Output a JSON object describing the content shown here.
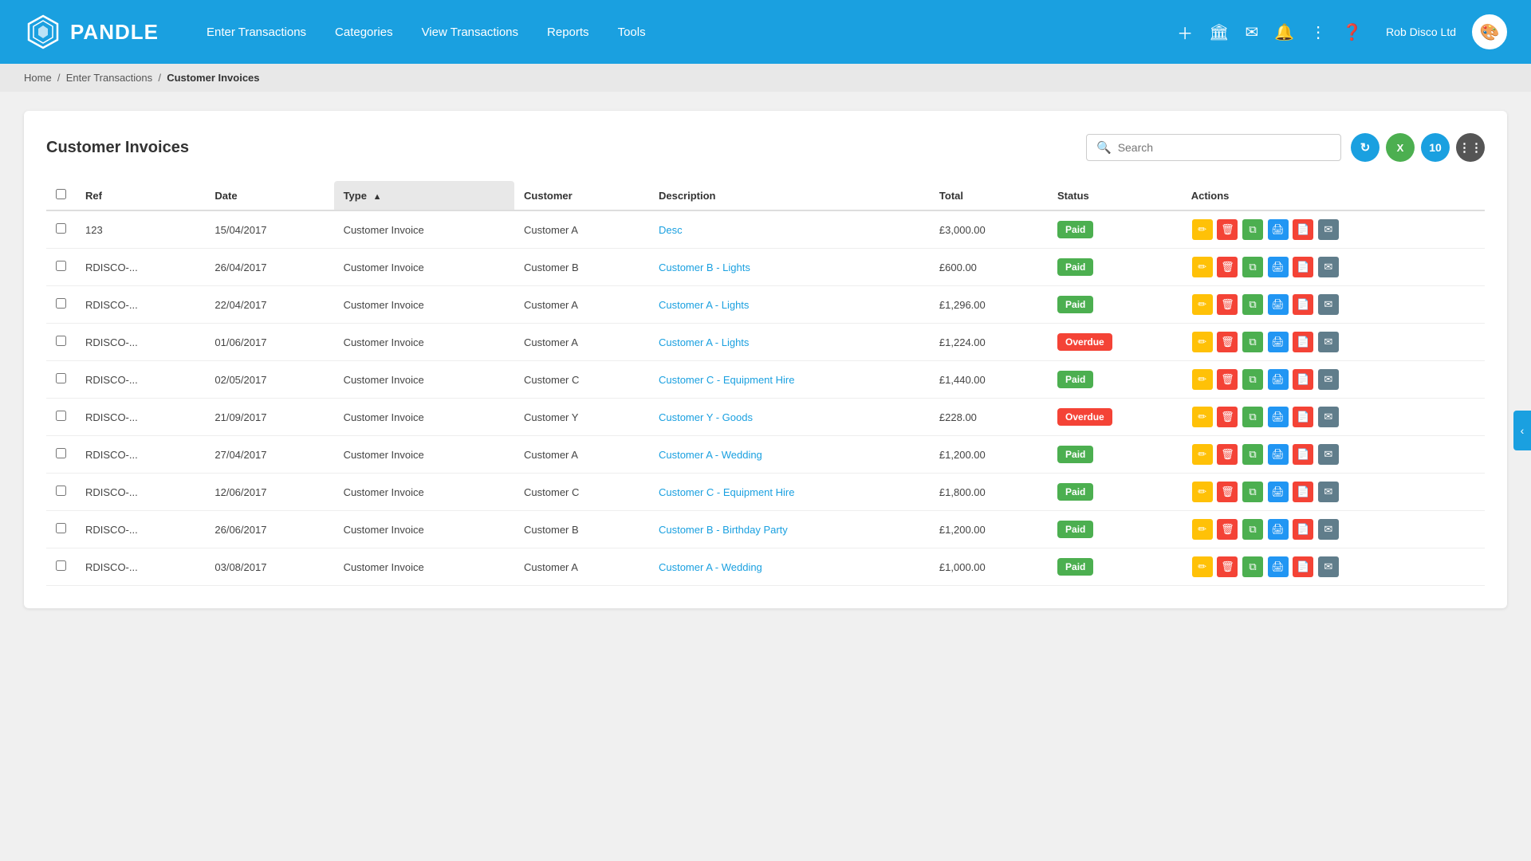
{
  "app": {
    "name": "PANDLE"
  },
  "header": {
    "company": "Rob Disco Ltd",
    "nav": [
      {
        "label": "Enter Transactions",
        "id": "nav-enter-transactions"
      },
      {
        "label": "Categories",
        "id": "nav-categories"
      },
      {
        "label": "View Transactions",
        "id": "nav-view-transactions"
      },
      {
        "label": "Reports",
        "id": "nav-reports"
      },
      {
        "label": "Tools",
        "id": "nav-tools"
      }
    ]
  },
  "breadcrumb": {
    "items": [
      "Home",
      "Enter Transactions",
      "Customer Invoices"
    ]
  },
  "page": {
    "title": "Customer Invoices",
    "search_placeholder": "Search"
  },
  "toolbar": {
    "refresh_label": "↻",
    "excel_label": "X",
    "count_label": "10",
    "columns_label": "⋮⋮"
  },
  "table": {
    "columns": [
      "Ref",
      "Date",
      "Type",
      "Customer",
      "Description",
      "Total",
      "Status",
      "Actions"
    ],
    "rows": [
      {
        "ref": "123",
        "date": "15/04/2017",
        "type": "Customer Invoice",
        "customer": "Customer A",
        "description": "Desc",
        "total": "£3,000.00",
        "status": "Paid"
      },
      {
        "ref": "RDISCO-...",
        "date": "26/04/2017",
        "type": "Customer Invoice",
        "customer": "Customer B",
        "description": "Customer B - Lights",
        "total": "£600.00",
        "status": "Paid"
      },
      {
        "ref": "RDISCO-...",
        "date": "22/04/2017",
        "type": "Customer Invoice",
        "customer": "Customer A",
        "description": "Customer A - Lights",
        "total": "£1,296.00",
        "status": "Paid"
      },
      {
        "ref": "RDISCO-...",
        "date": "01/06/2017",
        "type": "Customer Invoice",
        "customer": "Customer A",
        "description": "Customer A - Lights",
        "total": "£1,224.00",
        "status": "Overdue"
      },
      {
        "ref": "RDISCO-...",
        "date": "02/05/2017",
        "type": "Customer Invoice",
        "customer": "Customer C",
        "description": "Customer C - Equipment Hire",
        "total": "£1,440.00",
        "status": "Paid"
      },
      {
        "ref": "RDISCO-...",
        "date": "21/09/2017",
        "type": "Customer Invoice",
        "customer": "Customer Y",
        "description": "Customer Y - Goods",
        "total": "£228.00",
        "status": "Overdue"
      },
      {
        "ref": "RDISCO-...",
        "date": "27/04/2017",
        "type": "Customer Invoice",
        "customer": "Customer A",
        "description": "Customer A - Wedding",
        "total": "£1,200.00",
        "status": "Paid"
      },
      {
        "ref": "RDISCO-...",
        "date": "12/06/2017",
        "type": "Customer Invoice",
        "customer": "Customer C",
        "description": "Customer C - Equipment Hire",
        "total": "£1,800.00",
        "status": "Paid"
      },
      {
        "ref": "RDISCO-...",
        "date": "26/06/2017",
        "type": "Customer Invoice",
        "customer": "Customer B",
        "description": "Customer B - Birthday Party",
        "total": "£1,200.00",
        "status": "Paid"
      },
      {
        "ref": "RDISCO-...",
        "date": "03/08/2017",
        "type": "Customer Invoice",
        "customer": "Customer A",
        "description": "Customer A - Wedding",
        "total": "£1,000.00",
        "status": "Paid"
      }
    ]
  }
}
